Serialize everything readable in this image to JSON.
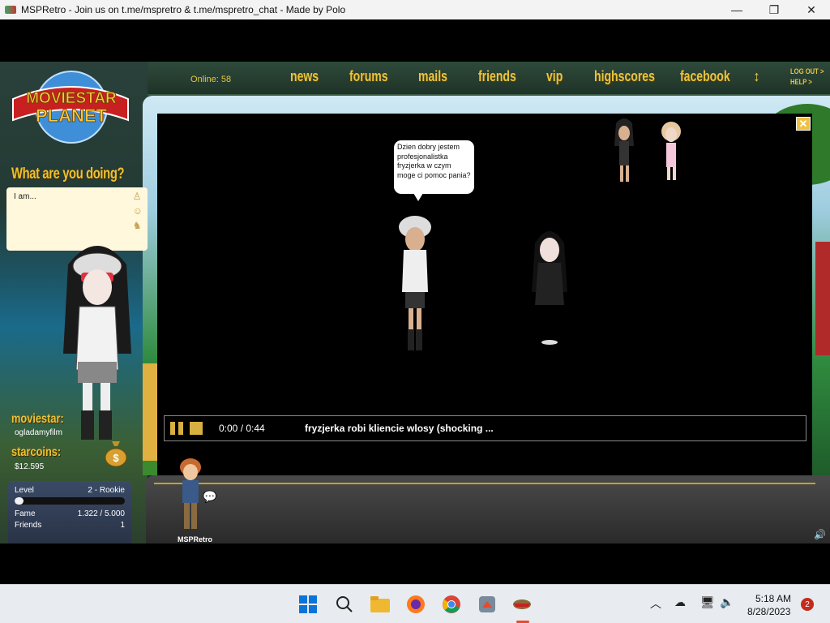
{
  "window": {
    "title": "MSPRetro - Join us on t.me/mspretro & t.me/mspretro_chat - Made by Polo",
    "minimize_glyph": "—",
    "maximize_glyph": "❐",
    "close_glyph": "✕"
  },
  "logo": {
    "line1": "MOVIESTAR",
    "line2": "PLANET"
  },
  "status": {
    "prompt": "What are you doing?",
    "text": "I am..."
  },
  "profile": {
    "moviestar_label": "moviestar:",
    "username": "ogladamyfilm",
    "starcoins_label": "starcoins:",
    "starcoins": "$12.595"
  },
  "stats": {
    "level_label": "Level",
    "level_value": "2 - Rookie",
    "level_progress": 0.08,
    "fame_label": "Fame",
    "fame_value": "1.322 / 5.000",
    "friends_label": "Friends",
    "friends_value": "1"
  },
  "nav": {
    "online": "Online: 58",
    "items": [
      "news",
      "forums",
      "mails",
      "friends",
      "vip",
      "highscores",
      "facebook"
    ],
    "logout": "LOG OUT >",
    "help": "HELP >"
  },
  "player": {
    "speech": "Dzien dobry jestem profesjonalistka fryzjerka w czym moge ci pomoc pania?",
    "time": "0:00 / 0:44",
    "title": "fryzjerka robi kliencie wlosy (shocking ...",
    "close_glyph": "✕"
  },
  "dock": {
    "avatar_name": "MSPRetro"
  },
  "taskbar": {
    "time": "5:18 AM",
    "date": "8/28/2023",
    "notifications": "2"
  },
  "colors": {
    "accent_gold": "#e8c440",
    "panel_dark": "#1f3328",
    "player_control": "#d8b040"
  }
}
